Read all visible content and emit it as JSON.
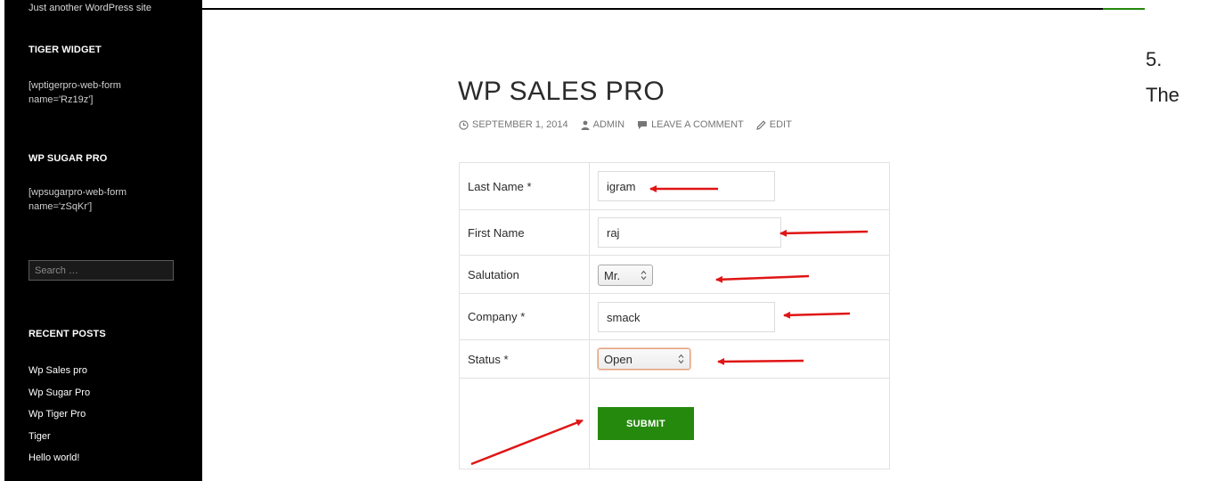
{
  "sidebar": {
    "tagline": "Just another WordPress site",
    "tiger_widget": {
      "title": "TIGER WIDGET",
      "shortcode_line1": "[wptigerpro-web-form",
      "shortcode_line2": "name='Rz19z']"
    },
    "sugar_widget": {
      "title": "WP SUGAR PRO",
      "shortcode_line1": "[wpsugarpro-web-form",
      "shortcode_line2": "name='zSqKr']"
    },
    "search": {
      "placeholder": "Search …"
    },
    "recent_posts": {
      "title": "RECENT POSTS",
      "items": [
        {
          "label": "Wp Sales pro"
        },
        {
          "label": "Wp Sugar Pro"
        },
        {
          "label": "Wp Tiger Pro"
        },
        {
          "label": "Tiger"
        },
        {
          "label": "Hello world!"
        }
      ]
    }
  },
  "post": {
    "title": "WP SALES PRO",
    "meta": {
      "date": "SEPTEMBER 1, 2014",
      "author": "ADMIN",
      "comment": "LEAVE A COMMENT",
      "edit": "EDIT"
    }
  },
  "form": {
    "rows": [
      {
        "label": "Last Name *",
        "value": "igram"
      },
      {
        "label": "First Name",
        "value": "raj"
      },
      {
        "label": "Salutation",
        "value": "Mr."
      },
      {
        "label": "Company *",
        "value": "smack"
      },
      {
        "label": "Status *",
        "value": "Open"
      }
    ],
    "submit_label": "SUBMIT"
  },
  "note": {
    "number": "5.",
    "word": "The"
  },
  "colors": {
    "accent": "#24890d",
    "arrow": "#e01515",
    "sidebar_bg": "#000000"
  },
  "icons": {
    "date": "clock-icon",
    "author": "user-icon",
    "comment": "comment-icon",
    "edit": "pencil-icon",
    "select": "spinner-arrows-icon"
  }
}
